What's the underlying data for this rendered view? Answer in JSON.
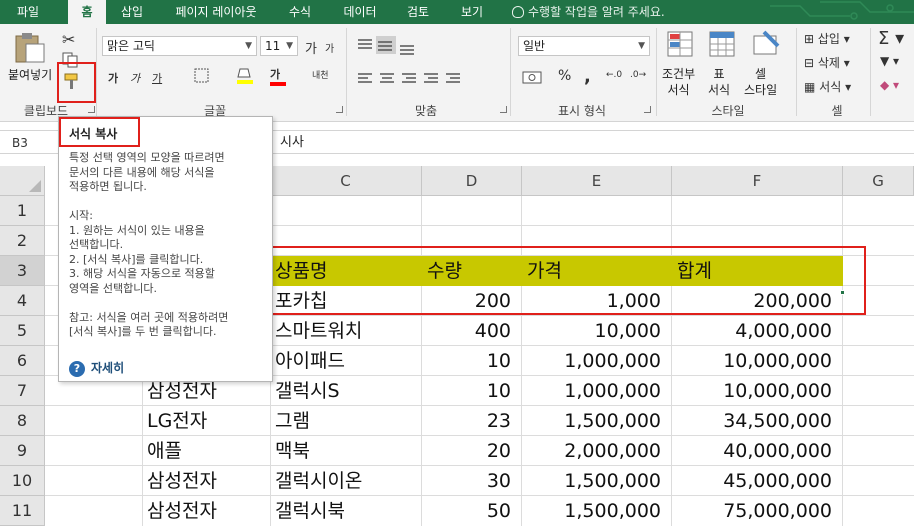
{
  "tabs": [
    {
      "label": "파일",
      "active": false
    },
    {
      "label": "홈",
      "active": true
    },
    {
      "label": "삽입",
      "active": false
    },
    {
      "label": "페이지 레이아웃",
      "active": false
    },
    {
      "label": "수식",
      "active": false
    },
    {
      "label": "데이터",
      "active": false
    },
    {
      "label": "검토",
      "active": false
    },
    {
      "label": "보기",
      "active": false
    }
  ],
  "tell_me": "수행할 작업을 알려 주세요.",
  "ribbon": {
    "clipboard": {
      "label": "클립보드",
      "paste": "붙여넣기"
    },
    "font": {
      "label": "글꼴",
      "name": "맑은 고딕",
      "size": "11",
      "grow": "가",
      "shrink": "가",
      "bold": "가",
      "italic": "가",
      "underline": "가",
      "color_glyph": "가",
      "phonetic": "내천"
    },
    "align": {
      "label": "맞춤"
    },
    "number": {
      "label": "표시 형식",
      "format": "일반",
      "percent": "%",
      "comma": ","
    },
    "styles": {
      "label": "스타일",
      "conditional": "조건부\n서식",
      "table": "표\n서식",
      "cell_style": "셀\n스타일"
    },
    "cells": {
      "label": "셀",
      "insert": "삽입",
      "delete": "삭제",
      "format": "서식"
    }
  },
  "name_box": "B3",
  "formula_content": "시사",
  "columns": [
    "C",
    "D",
    "E",
    "F",
    "G"
  ],
  "rows": [
    "1",
    "2",
    "3",
    "4",
    "5",
    "6",
    "7",
    "8",
    "9",
    "10",
    "11"
  ],
  "table_header": {
    "product": "상품명",
    "qty": "수량",
    "price": "가격",
    "total": "합계"
  },
  "table_rows": [
    {
      "row": "4",
      "company": "",
      "product": "포카칩",
      "qty": "200",
      "price": "1,000",
      "total": "200,000"
    },
    {
      "row": "5",
      "company": "",
      "product": "스마트워치",
      "qty": "400",
      "price": "10,000",
      "total": "4,000,000"
    },
    {
      "row": "6",
      "company": "",
      "product": "아이패드",
      "qty": "10",
      "price": "1,000,000",
      "total": "10,000,000"
    },
    {
      "row": "7",
      "company": "삼성전자",
      "product": "갤럭시S",
      "qty": "10",
      "price": "1,000,000",
      "total": "10,000,000"
    },
    {
      "row": "8",
      "company": "LG전자",
      "product": "그램",
      "qty": "23",
      "price": "1,500,000",
      "total": "34,500,000"
    },
    {
      "row": "9",
      "company": "애플",
      "product": "맥북",
      "qty": "20",
      "price": "2,000,000",
      "total": "40,000,000"
    },
    {
      "row": "10",
      "company": "삼성전자",
      "product": "갤럭시이온",
      "qty": "30",
      "price": "1,500,000",
      "total": "45,000,000"
    },
    {
      "row": "11",
      "company": "삼성전자",
      "product": "갤럭시북",
      "qty": "50",
      "price": "1,500,000",
      "total": "75,000,000"
    }
  ],
  "tooltip": {
    "title": "서식 복사",
    "body": [
      "특정 선택 영역의 모양을 따르려면",
      "문서의 다른 내용에 해당 서식을",
      "적용하면 됩니다.",
      "",
      "시작:",
      "1. 원하는 서식이 있는 내용을",
      "선택합니다.",
      "2. [서식 복사]를 클릭합니다.",
      "3. 해당 서식을 자동으로 적용할",
      "영역을 선택합니다.",
      "",
      "참고: 서식을 여러 곳에 적용하려면",
      "[서식 복사]를 두 번 클릭합니다."
    ],
    "help": "자세히"
  },
  "colors": {
    "excel_green": "#217346",
    "highlight_red": "#e0201b",
    "header_fill": "#c8c800"
  }
}
